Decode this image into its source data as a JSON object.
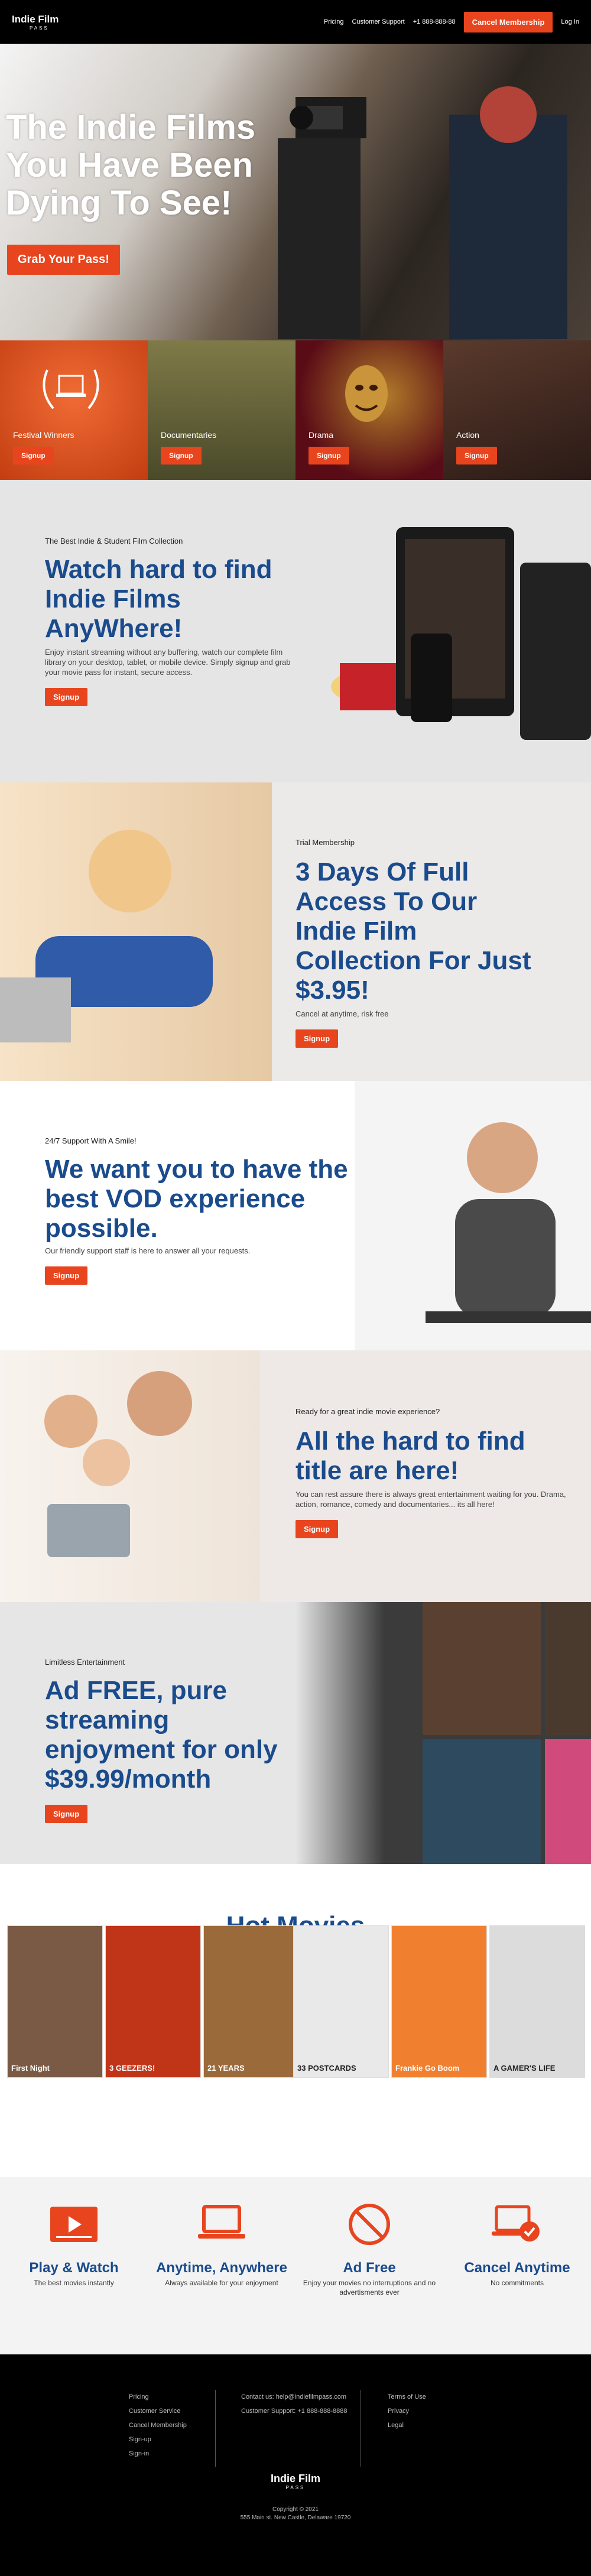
{
  "brand": {
    "logo_text": "Indie Film",
    "logo_sub": "PASS"
  },
  "nav": {
    "items": [
      "Pricing",
      "Customer Support",
      "+1 888-888-88"
    ],
    "cancel": "Cancel Membership",
    "login": "Log In"
  },
  "hero": {
    "headline": "The Indie Films You Have Been Dying To See!",
    "cta": "Grab Your Pass!"
  },
  "categories": [
    {
      "label": "Festival Winners",
      "cta": "Signup",
      "bg": "#d24a17"
    },
    {
      "label": "Documentaries",
      "cta": "Signup",
      "bg": "#5e5a33"
    },
    {
      "label": "Drama",
      "cta": "Signup",
      "bg": "#6a0f1a"
    },
    {
      "label": "Action",
      "cta": "Signup",
      "bg": "#3a2720"
    }
  ],
  "sections": {
    "s1": {
      "kicker": "The Best Indie & Student Film Collection",
      "headline": "Watch hard to find Indie Films AnyWhere!",
      "body": "Enjoy instant streaming without any buffering, watch our complete film library on your desktop, tablet, or mobile device. Simply signup and grab your movie pass for instant, secure access.",
      "cta": "Signup"
    },
    "s2": {
      "kicker": "Trial Membership",
      "headline": "3 Days Of Full Access To Our Indie Film Collection For Just $3.95!",
      "body": "Cancel at anytime, risk free",
      "cta": "Signup"
    },
    "s3": {
      "kicker": "24/7 Support With A Smile!",
      "headline": "We want you to have the best VOD experience possible.",
      "body": "Our friendly support staff is here to answer all your requests.",
      "cta": "Signup"
    },
    "s4": {
      "kicker": "Ready for a great indie movie experience?",
      "headline": "All the hard to find title are here!",
      "body": "You can rest assure there is always great entertainment waiting for you. Drama, action, romance, comedy and documentaries... its all here!",
      "cta": "Signup"
    },
    "s5": {
      "kicker": "Limitless Entertainment",
      "headline": "Ad FREE, pure streaming enjoyment for only $39.99/month",
      "cta": "Signup"
    }
  },
  "hot": {
    "title": "Hot Movies",
    "posters": [
      {
        "title": "First Night",
        "color": "#7a5a44"
      },
      {
        "title": "3 GEEZERS!",
        "color": "#c03418"
      },
      {
        "title": "21 YEARS",
        "color": "#9b6a3a"
      },
      {
        "title": "33 POSTCARDS",
        "color": "#e9e9e9"
      },
      {
        "title": "Frankie Go Boom",
        "color": "#f08030"
      },
      {
        "title": "A GAMER'S LIFE",
        "color": "#dcdcdc"
      }
    ]
  },
  "features": [
    {
      "title": "Play & Watch",
      "desc": "The best movies instantly",
      "icon": "play-window-icon"
    },
    {
      "title": "Anytime, Anywhere",
      "desc": "Always available for your enjoyment",
      "icon": "laptop-icon"
    },
    {
      "title": "Ad Free",
      "desc": "Enjoy your movies no interruptions and no advertisments ever",
      "icon": "no-ads-icon"
    },
    {
      "title": "Cancel Anytime",
      "desc": "No commitments",
      "icon": "cancel-laptop-icon"
    }
  ],
  "footer": {
    "col1": [
      "Pricing",
      "Customer Service",
      "Cancel Membership",
      "Sign-up",
      "Sign-in"
    ],
    "col2": [
      "Contact us: help@indiefilmpass.com",
      "Customer Support: +1 888-888-8888"
    ],
    "col3": [
      "Terms of Use",
      "Privacy",
      "Legal"
    ],
    "copyright": "Copyright © 2021",
    "address": "555 Main st. New Castle, Delaware 19720"
  },
  "colors": {
    "accent": "#e8451e",
    "blue": "#1a4b8c"
  }
}
